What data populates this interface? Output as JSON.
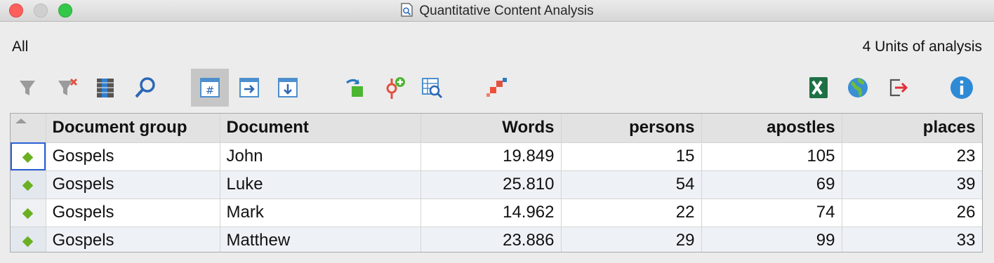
{
  "window": {
    "title": "Quantitative Content Analysis"
  },
  "header": {
    "scope": "All",
    "units_label": "4 Units of analysis"
  },
  "toolbar": {
    "icons": [
      "filter-icon",
      "clear-filter-icon",
      "table-columns-icon",
      "search-icon",
      "count-hash-icon",
      "move-right-icon",
      "move-down-icon",
      "export-to-set-icon",
      "add-code-icon",
      "view-table-icon",
      "tiles-icon",
      "excel-icon",
      "globe-icon",
      "export-icon",
      "info-icon"
    ],
    "colors": {
      "excel": "#1e7145",
      "info": "#2f8ad6",
      "accent": "#f0503a"
    }
  },
  "table": {
    "columns": [
      "Document group",
      "Document",
      "Words",
      "persons",
      "apostles",
      "places"
    ],
    "rows": [
      {
        "group": "Gospels",
        "document": "John",
        "words": "19.849",
        "persons": "15",
        "apostles": "105",
        "places": "23"
      },
      {
        "group": "Gospels",
        "document": "Luke",
        "words": "25.810",
        "persons": "54",
        "apostles": "69",
        "places": "39"
      },
      {
        "group": "Gospels",
        "document": "Mark",
        "words": "14.962",
        "persons": "22",
        "apostles": "74",
        "places": "26"
      },
      {
        "group": "Gospels",
        "document": "Matthew",
        "words": "23.886",
        "persons": "29",
        "apostles": "99",
        "places": "33"
      }
    ]
  }
}
